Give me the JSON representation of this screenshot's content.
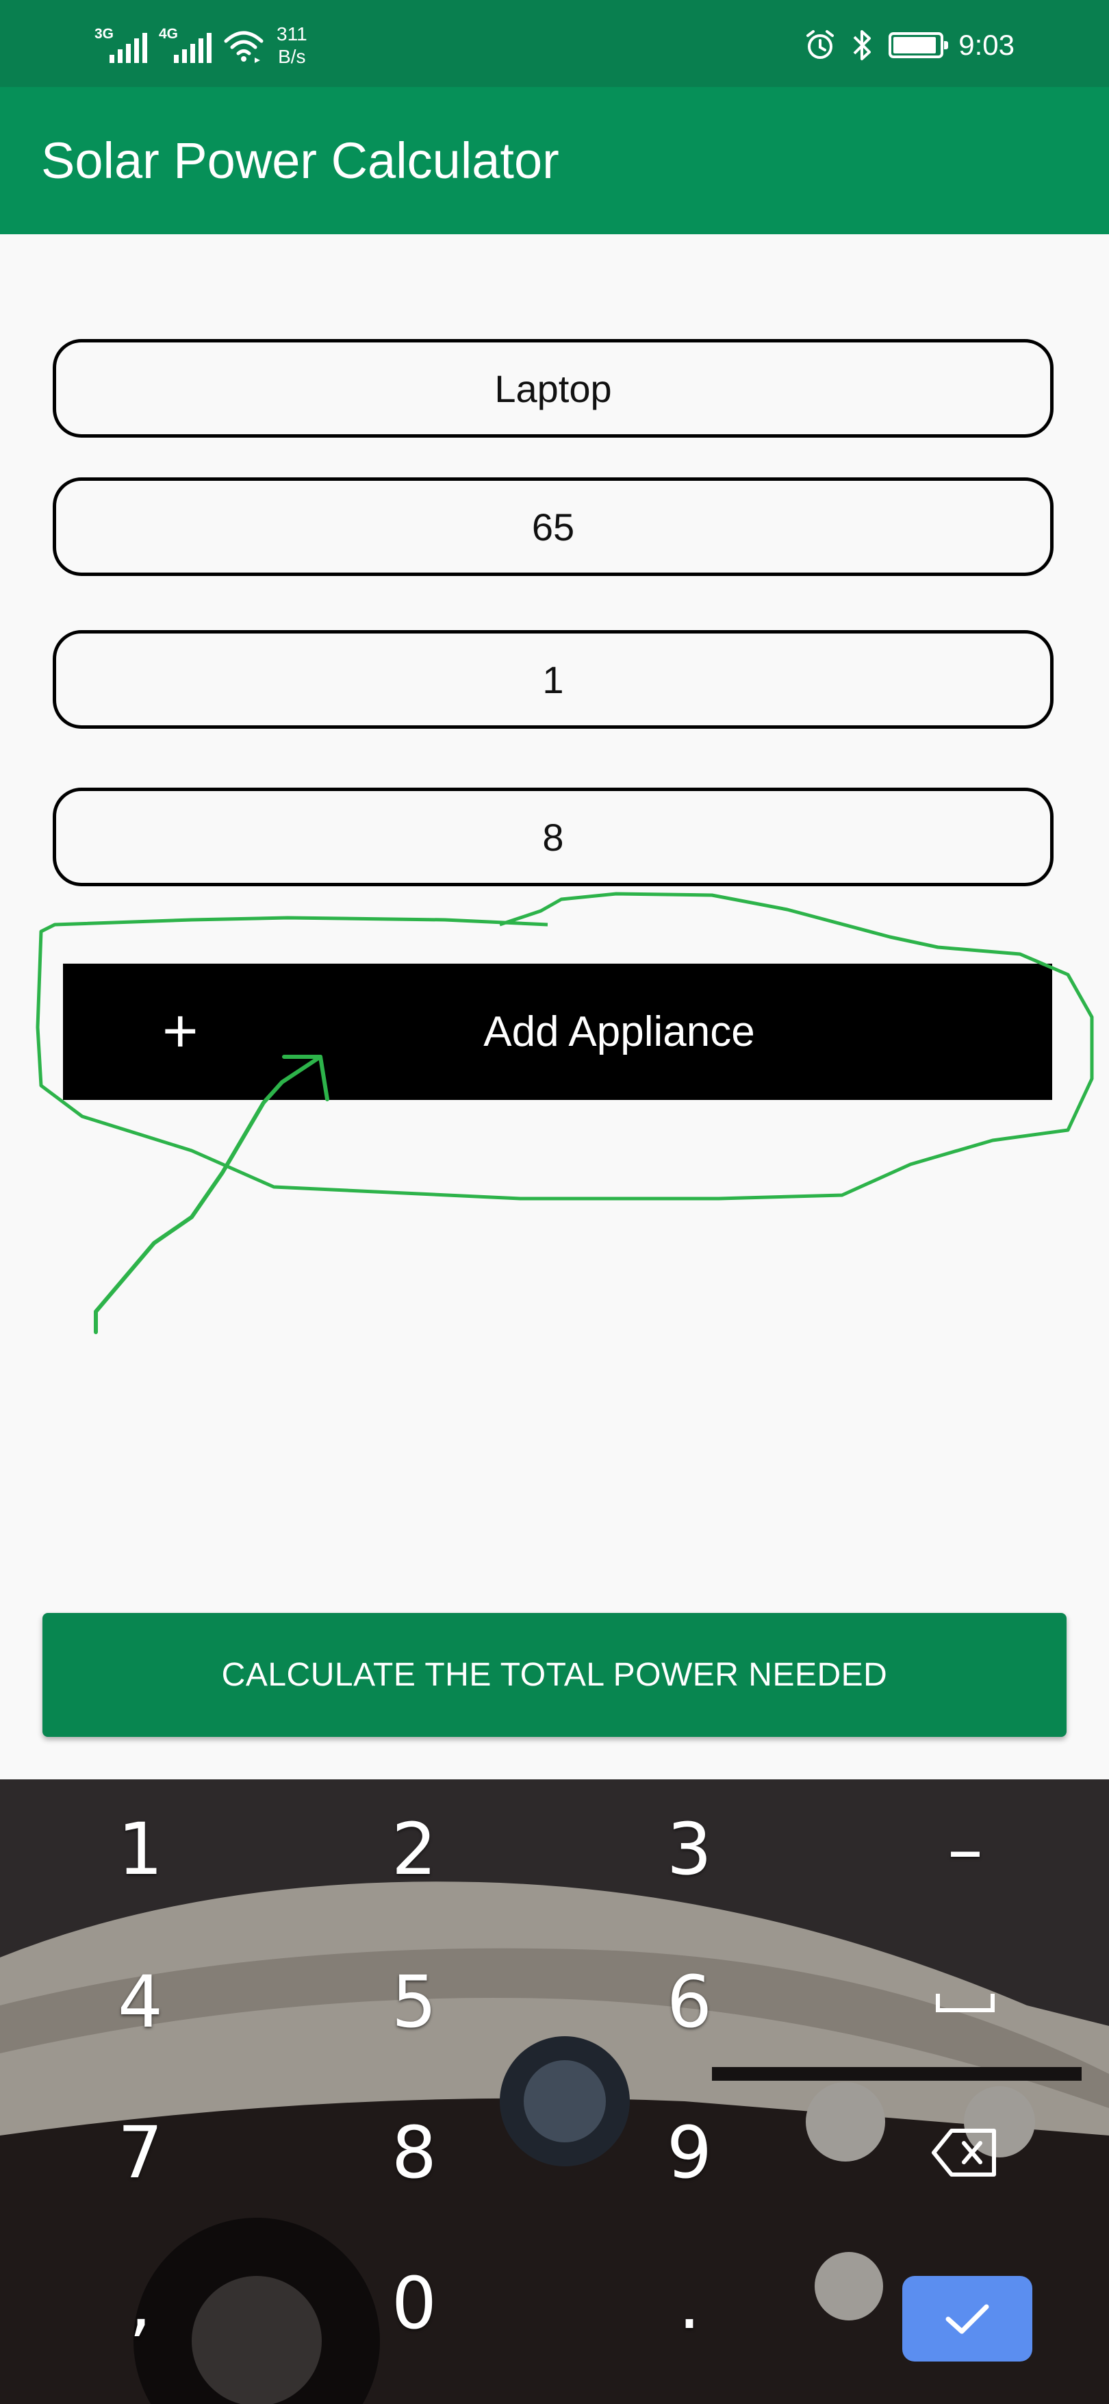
{
  "status_bar": {
    "net1": "3G",
    "net2": "4G",
    "speed_value": "311",
    "speed_unit": "B/s",
    "time": "9:03",
    "icons": [
      "signal-icon",
      "signal-icon",
      "wifi-icon",
      "alarm-icon",
      "bluetooth-icon",
      "battery-icon"
    ]
  },
  "app_bar": {
    "title": "Solar Power Calculator"
  },
  "form": {
    "appliance_name": "Laptop",
    "watts": "65",
    "quantity": "1",
    "hours": "8"
  },
  "add_button": {
    "icon": "+",
    "label": "Add Appliance"
  },
  "calculate_button": {
    "label": "CALCULATE THE TOTAL POWER NEEDED"
  },
  "keyboard": {
    "keys": [
      "1",
      "2",
      "3",
      "–",
      "4",
      "5",
      "6",
      "␣",
      "7",
      "8",
      "9",
      "⌫",
      ",",
      "0",
      ".",
      "✓"
    ]
  },
  "colors": {
    "status_bar": "#097f4f",
    "app_bar": "#069058",
    "calculate_button": "#088650",
    "annotation": "#2db34a",
    "done_key": "#5b8ef0"
  }
}
